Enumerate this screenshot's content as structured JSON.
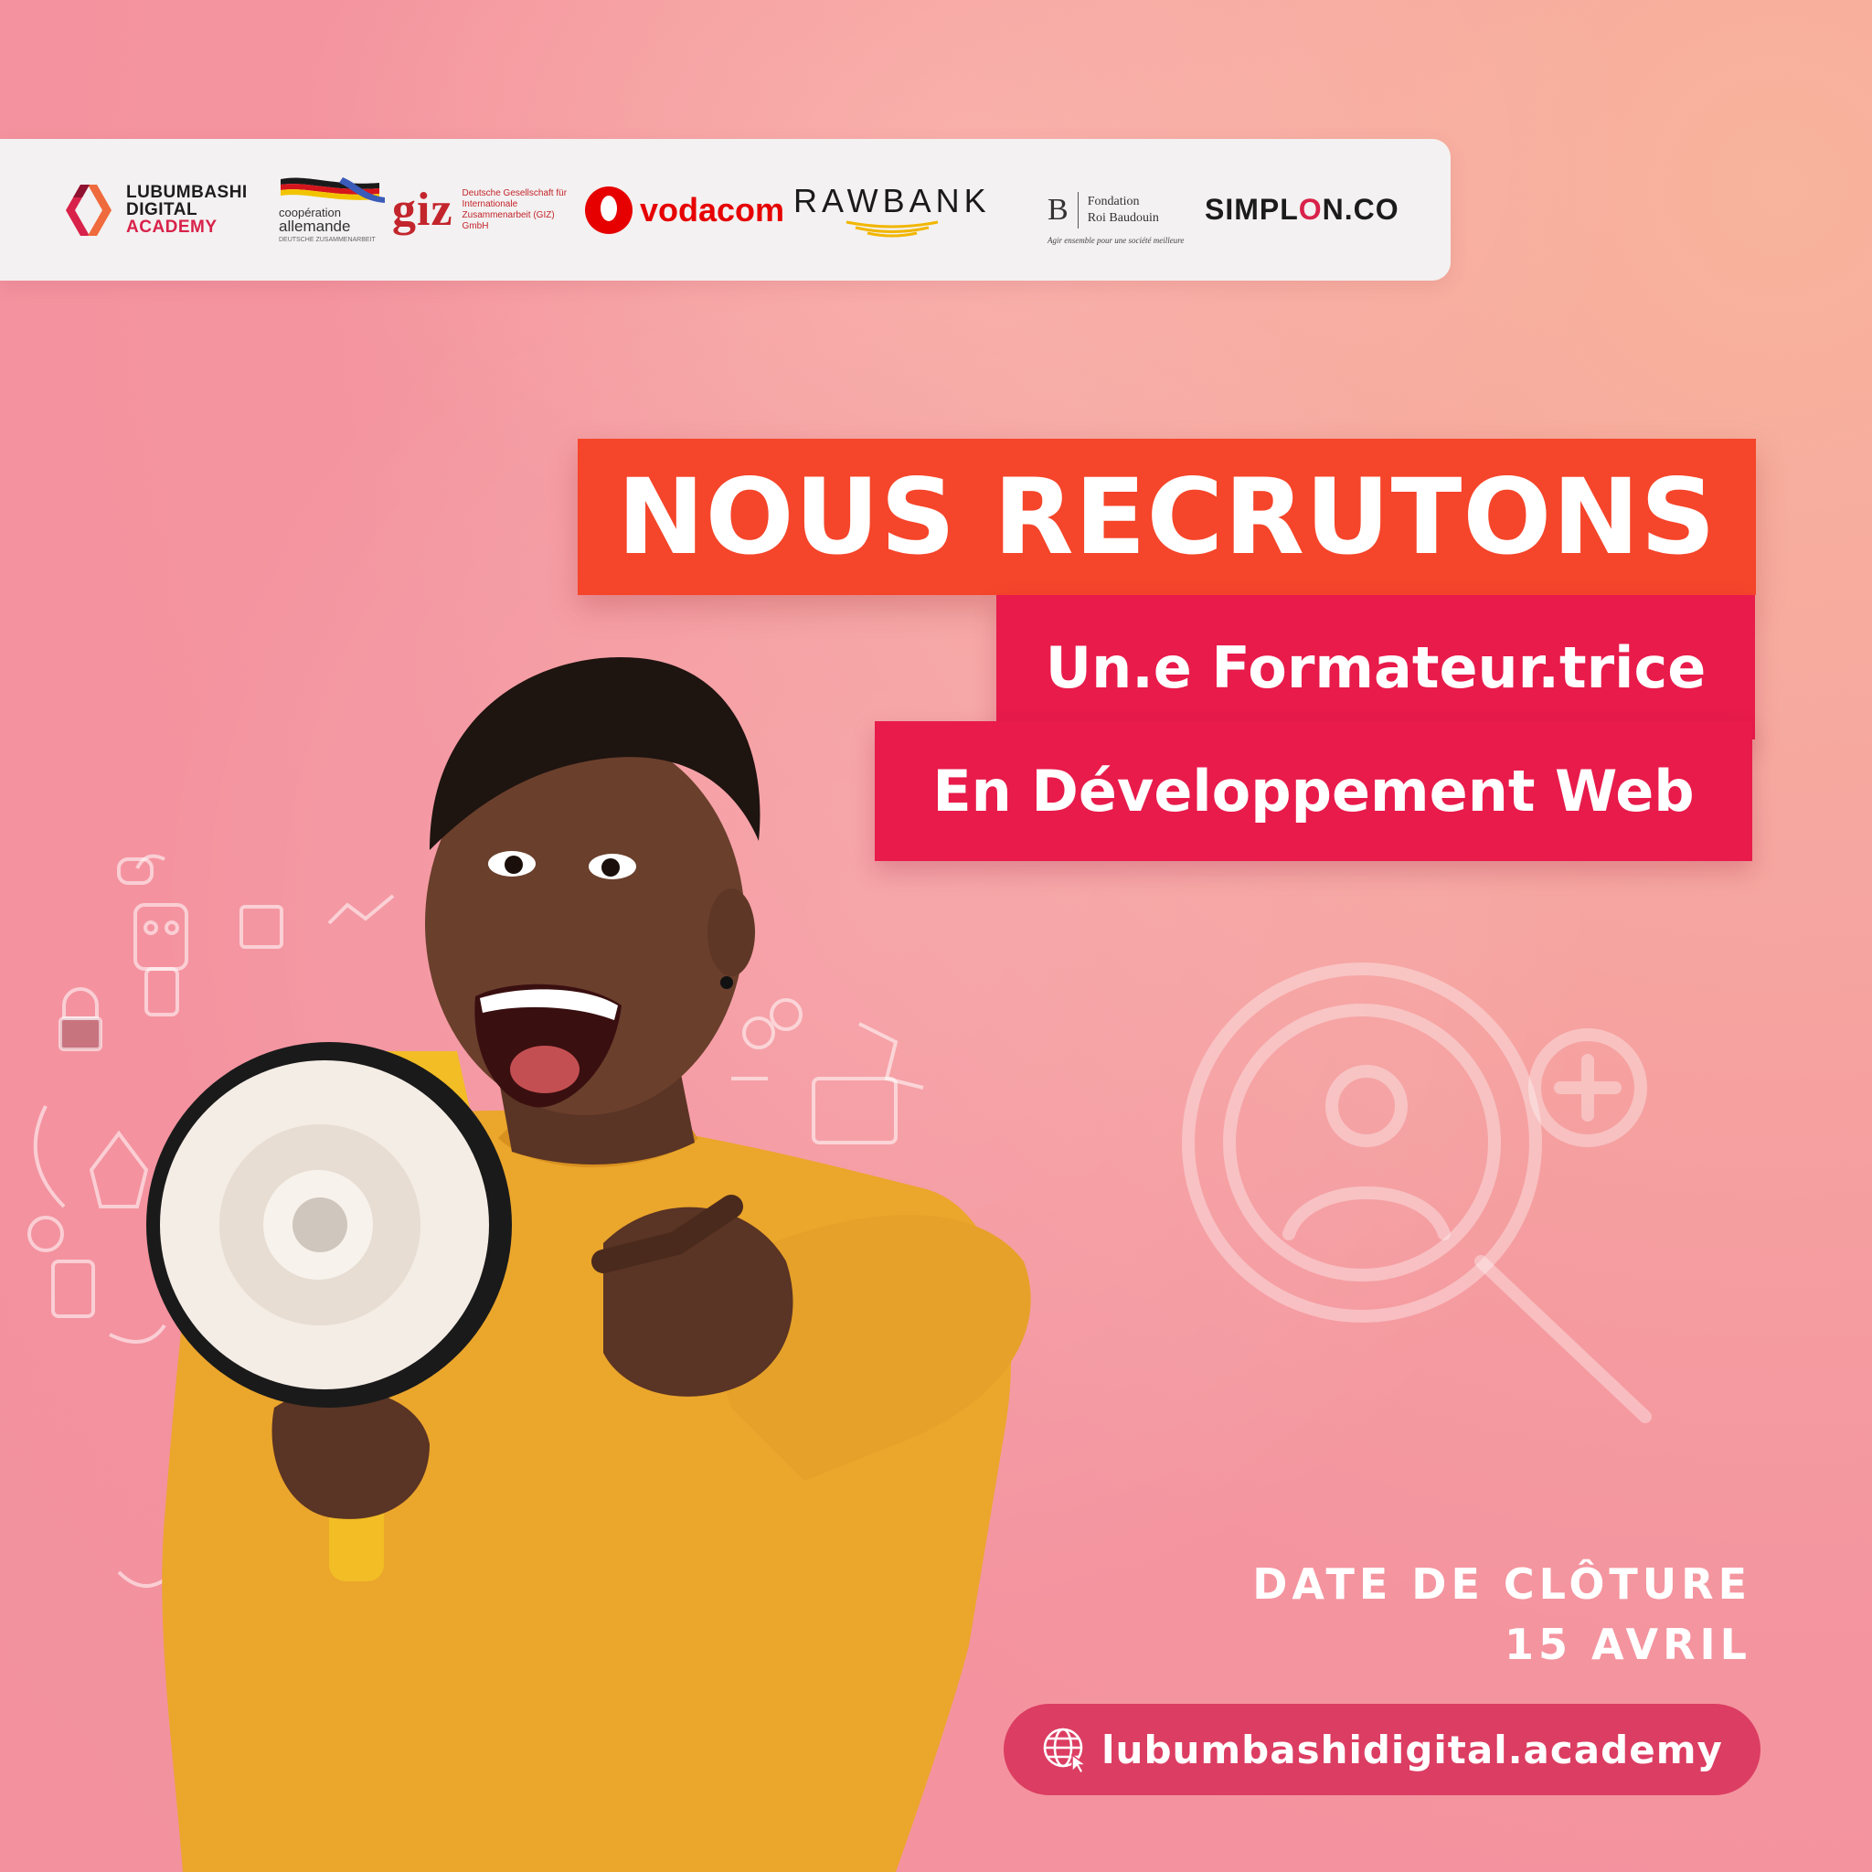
{
  "partners": {
    "lda": {
      "line1": "LUBUMBASHI",
      "line2": "DIGITAL",
      "line3": "ACADEMY"
    },
    "giz": {
      "coop_line1": "coopération",
      "coop_line2": "allemande",
      "coop_line3": "DEUTSCHE ZUSAMMENARBEIT",
      "word": "giz",
      "desc": "Deutsche Gesellschaft für Internationale Zusammenarbeit (GIZ) GmbH"
    },
    "vodacom": "vodacom",
    "rawbank": "RAWBANK",
    "frb": {
      "initial": "B",
      "line1": "Fondation",
      "line2": "Roi Baudouin",
      "tagline": "Agir ensemble pour une société meilleure"
    },
    "simplon": {
      "pre": "SIMPL",
      "o": "O",
      "post": "N.CO"
    }
  },
  "headline": "NOUS RECRUTONS",
  "subline1": "Un.e Formateur.trice",
  "subline2": "En Développement Web",
  "closing": {
    "label": "DATE DE CLÔTURE",
    "date": "15 AVRIL"
  },
  "website": "lubumbashidigital.academy",
  "colors": {
    "title_bg": "#f5452a",
    "subtitle_bg": "#e81b4b",
    "pill_bg": "#dc3d62",
    "sweater": "#eba62c"
  }
}
